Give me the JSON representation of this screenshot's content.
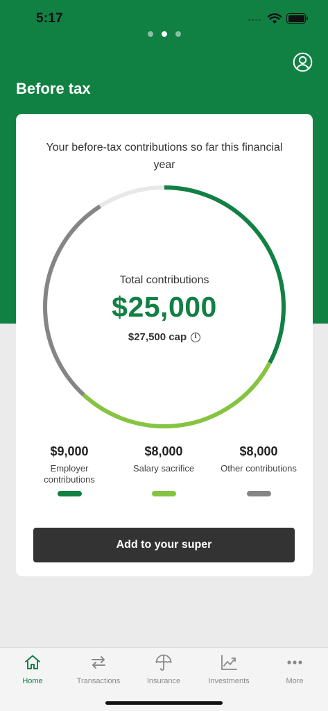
{
  "status_bar": {
    "time": "5:17"
  },
  "header": {
    "title": "Before tax",
    "page_count": 3,
    "active_page": 2
  },
  "card": {
    "description": "Your before-tax contributions so far this financial year",
    "total_label": "Total contributions",
    "total_value": "$25,000",
    "cap_label": "$27,500 cap",
    "legend": [
      {
        "amount": "$9,000",
        "label": "Employer contributions",
        "color": "#118043",
        "value": 9000
      },
      {
        "amount": "$8,000",
        "label": "Salary sacrifice",
        "color": "#86c440",
        "value": 8000
      },
      {
        "amount": "$8,000",
        "label": "Other contributions",
        "color": "#858585",
        "value": 8000
      }
    ],
    "cap_value": 27500,
    "button_label": "Add to your super"
  },
  "tabs": [
    {
      "label": "Home",
      "icon": "home-icon",
      "active": true
    },
    {
      "label": "Transactions",
      "icon": "transfer-arrows-icon",
      "active": false
    },
    {
      "label": "Insurance",
      "icon": "umbrella-icon",
      "active": false
    },
    {
      "label": "Investments",
      "icon": "line-chart-icon",
      "active": false
    },
    {
      "label": "More",
      "icon": "more-dots-icon",
      "active": false
    }
  ],
  "colors": {
    "brand_green": "#118043",
    "light_green": "#86c440",
    "grey": "#858585",
    "track": "#e8e8e8"
  }
}
